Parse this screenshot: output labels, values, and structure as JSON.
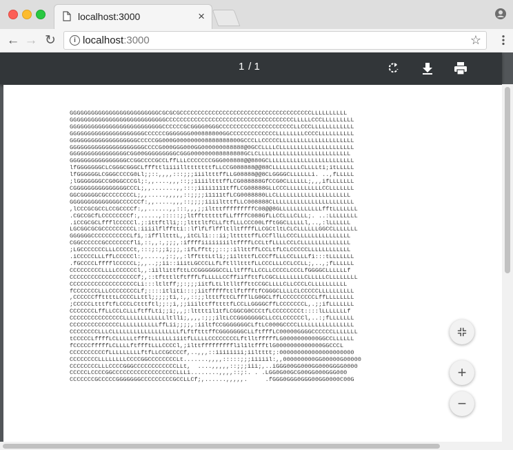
{
  "browser": {
    "tab_title": "localhost:3000",
    "tab_close": "×",
    "url_host": "localhost",
    "url_port": ":3000"
  },
  "pdf": {
    "page_current": "1",
    "page_separator": "/",
    "page_total": "1",
    "controls": {
      "rotate": "rotate-icon",
      "download": "download-icon",
      "print": "print-icon",
      "fit": "fit-to-page-icon",
      "zoom_in": "+",
      "zoom_out": "−"
    },
    "ascii_art": "GGGGGGGGGGGGGGGGGGGGGGGGGCGCGCGCCCCCCCCCCCCCCCCCCCCCCCCCCCCCCCCCCCCCLLLLLLLLLL\nGGGGGGGGGGGGGGGGGGGGGGGGGGGCCCCCCCCCCCCCCCCCCCCCCCCCCCCCCCCCCCCLLLLLCCCLLLLLLLLL\nGGGGGGGGGGGGGGGGGGGGGGGGGGCCCCCCGCGGGG0GGGCCCCCCCCCCCCCCCCCCCCCLLCCCLLLLLLLLLLLL\nGGGGGGGGGGGGGGGGGGGGGCCCCCCGGGGGGG000888800GGCCCCCCCCCCCCCLLLLLLLLCCCCLLLLLLLLLL\nGGGGGGGGGGGGGGGGGGGCCCCCGG000G000000008888888800GCCCLLCCCCCLLLLLLLLLLLLLLLLLLLLL\nGGGGGGGGGGGGGGGGGGGGGCCCCG000GGG000GG000000088888@0GCCLLLLCLLLLLLLLLLLLLLLLLLLLL\nGGGGGGGGGGGGGGGGCGG00GGGGGGGGGCGGG000000088888888GCLCLLLLLLLLLLLLLLLLLLLLLLLLLL\nGGGGGGGGGGGGGGGGCCGGCCCCGCCLffLLLCCCCCCCGGG008888@@880GCLLLLLLLLLLLLLLLLLLLLLLLL\nlfGGGGGGGCLCGGGCGGGCLfffttliiiilltttttttfLLCCG088888@@88CLLLLLLLLCLLLLti;itLLLLL\nlfGGGGGGLCGGGCCCCG0Ll;;::,,,,:::;;;iiiltttffLLG08888@@8CLGGGGCLLLLLLi. ..,fLLLLL\n;lGGGGGGGCCG0GGCCCGl;:,,....,,,::;;iiiiltttffLCG088888GfCCG0CLLLLLL;,,,ifLLLLLLL\nCGGGGGGGGGGGGGGGCCCL;,,.......,,:::;iiii1111tffLCG08888GLLCCCLLLLLLLLLLCCLLLLLLL\nGGCGGGGGCGCCCCCCCCL;,,.....,,,,,::;;;;i1111tfLCG0088880LLCLLLLLLLLLLLLLLLLLLLLL\nGGGGGGGGGGGGGGCCCCCCf:,,.....,,,::;;;;iiiiltttfLLC008888CLLLLLLLLLLLLLLLLLLLLLLL\n,lCCCGCGCCLCCGCCCCf:,,......,,:::,,,;;iltttfffffffffC08@@8GLLLLLLLLLLLLfftLLLLLLL\n.CGCCGCfLCCCCCCCCf:,.....,:::::;;ltffttttttfLLffffC088GfLLCCLLLCLLL;. ..:LLLLLLLL\n.iCCGCGCLffflCCCCCl.;:ittftlli;:;ltttltfCLLftfLLLCCC00LfftGGCLLLLLl,..,:lLLLLLL\nLGCGGCGCGCCCCCCCCCL:iiiilflfftti::lflfLflffltlltffffLLCGCtltLCLCLLLLLLGGCCLLLLLLL\nGGGGGGCCCCCCCCCCCLfi,:ifflltttL,,itCLli:::ii;ltttttffLCCfllLLCCCLLLLLLLLLLLLLLL\nCGGCCCCCCGCCCCCCCfli,::,,:,;;;,:iffffiiiiiiiiltffffLCCLtfLLLLCCLCLLLLLLLLLLLLLL\n;LGCCCCCCCLLLCCCCCt,:::;:;;i;;;,:ifLfftt;;::;:illttffLCCLtfLCLCCCCCLLLLLLLLLLLL\n.iCCCCCLLLffLCCCCCl:,.....,;:;,,:lfftttLtli;;iiltttfLCCCffLLLCCLLLLfi:::tLLLLLLL\n.fGCCCCLfffflCCCCCL;,,..;;ii::iiitLGCCCLLfLftllltttfLLCCCLLLCCLCCLL;,..,;fLLLLLL\nCCCCCCCCCLLLLCCCCCCl,,:iillittfttLCCGGGGGGCCLLltfffLLCCLLCCCCLCCCLfGGGGCLLLLLLf\nCCCCCCCCCCCCCCCCCCCf;,::tftttltftfffLfLLLLLCCffiiffttfLCGCLLLLLLLLCLLLLLCLLLLLLLL\nCCCCCCCCCCCCCCCCCCCLi:::ltltff;;:;;;iitfLtLltlltffttCCGCLLLLCLLCCCLCLLLLLLLLLL\nfCCCCCCCLLLCCCCCCCCLf;::::itliti:::;iitfffffttlftffftfCGGGCLLLLCLCCCCCLLLLLLLLLL\n,CCCCCCffttttLCCCCLLttl;;;;;ti,:,,::;;ltttfttCLffflLG0GCLffLCCCCCCCCCLffLLLLLLLL\n;CCCCCLtttftfLCCCLCtttftl;;:;i,;;iiilttffttttfLCCLLGGGGCffLCCCCCCCL,.;;ifLLLLLLL\nCCCCCCCLffLLCCLCLLLftffLti;;i;,,;:ltttt1l1tfLCGGCG0CCCtfLCCCCCCCCt::::lLLLLLLLf\nCCCCCCCCCCCCCCCLLLLLLLLLLLLltlli;,,,,:;;;iltLCCGGGGGGGCLLCCLCCCCCCl,..:;fLLLLLLL\nCCCCCCCCCCCCCCLLLLLLLLLLLffLii;;;;,:iiltfCCGGGGGGGCLftLC000GCCCCLLLLLLLLLLLLLLLL\nCCCCCCCCLLLCLLLLLLLLLLLLLLLLLLLfLftftttffCGGGGGGGCLLftfffLC00000GGGGCCCCCCLLLLLLL\ntCCCCCLffffLCLLLLLtffftLLLLLLiiitfLLLLLCCCCCCCCLftlltfffffLG0000000000GGCCLLLLLL\nfCCCCCfffffLCLLLLftffftLLLCCCCl,;ilttfffffffffl1l1ltffftlG0000000000000GGCCCL\nCCCCCCCCCCfLLLLLLLLLftfLLCCGCCCCf,..,,,::iiiiiiii;iiltttt;:000000000000000000000\nCCCCCCCCLLLLLLLLCCCCGGCCCCCCCCLt.......,,,,:::::;;;iiiiil:,,000000000GG00000G00000\nCCCCCCCCLLLCCCCGGGCCCCCCCCCCCCLLt,  ....,,,,,::;;;iii;,..iGGG00GG000GG000GGGG0000\nCCCCCLCCCCGGCCCCCCCCCCCCCCCCCCLLLi........,,,,::;:. . .LGG0G00GCG00GG000GGG000\nCCCCCCCGCCCCCGGGGGGGCCCCCCCCCGCCLLCf;,......,,,,,.     .fGGG0GGG0GGG00GG0000C00G"
  }
}
